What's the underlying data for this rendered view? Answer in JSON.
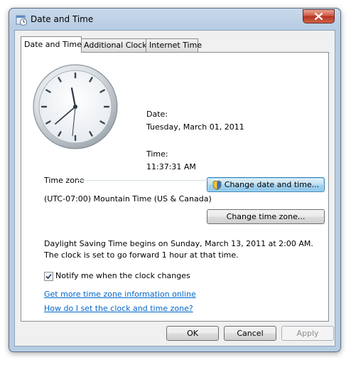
{
  "window": {
    "title": "Date and Time",
    "close_icon": "close-icon"
  },
  "tabs": [
    {
      "label": "Date and Time",
      "active": true
    },
    {
      "label": "Additional Clocks",
      "active": false
    },
    {
      "label": "Internet Time",
      "active": false
    }
  ],
  "date_section": {
    "date_label": "Date:",
    "date_value": "Tuesday, March 01, 2011",
    "time_label": "Time:",
    "time_value": "11:37:31 AM",
    "change_button": "Change date and time...",
    "change_button_icon": "shield-icon"
  },
  "timezone": {
    "heading": "Time zone",
    "value": "(UTC-07:00) Mountain Time (US & Canada)",
    "change_button": "Change time zone..."
  },
  "dst_message": "Daylight Saving Time begins on Sunday, March 13, 2011 at 2:00 AM. The clock is set to go forward 1 hour at that time.",
  "notify": {
    "label": "Notify me when the clock changes",
    "checked": true
  },
  "links": {
    "more_info": "Get more time zone information online",
    "how_to": "How do I set the clock and time zone?"
  },
  "footer": {
    "ok": "OK",
    "cancel": "Cancel",
    "apply": "Apply"
  },
  "colors": {
    "link": "#0066cc",
    "title_bar": "#b7cde3",
    "close_button": "#c94a34"
  }
}
